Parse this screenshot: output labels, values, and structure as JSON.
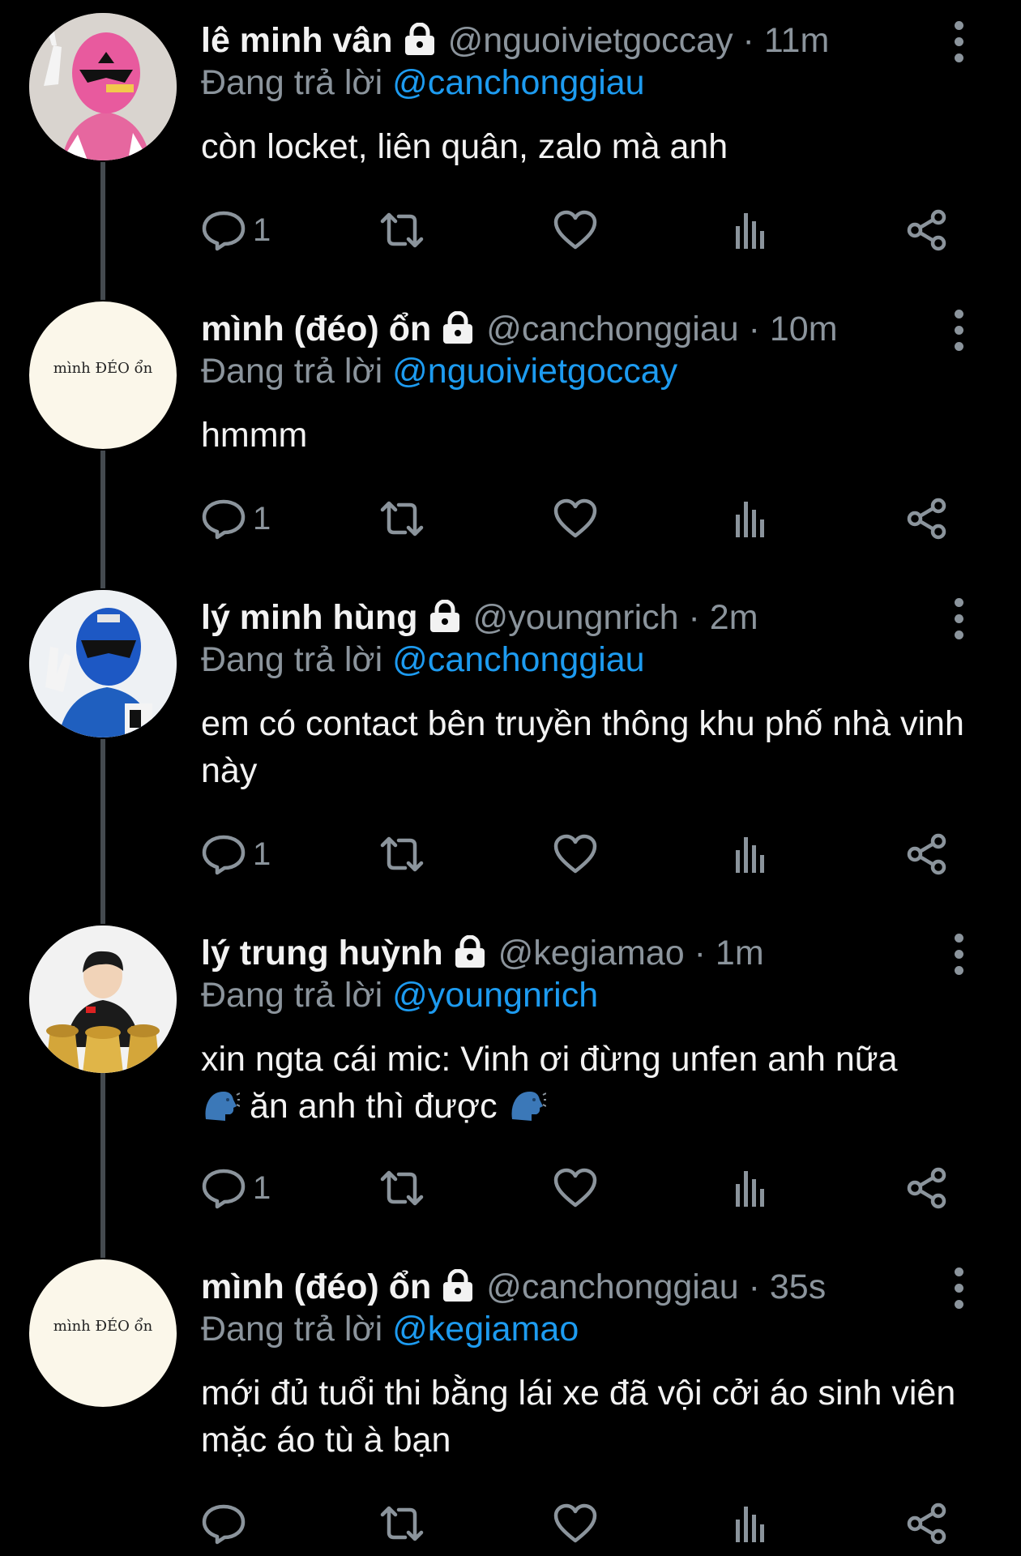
{
  "reply_prefix": "Đang trả lời",
  "tweets": [
    {
      "name": "lê minh vân",
      "handle": "@nguoivietgoccay",
      "time": "11m",
      "reply_to": "@canchonggiau",
      "text": "còn locket, liên quân, zalo mà anh",
      "reply_count": "1",
      "avatar": "pink-ranger-avatar"
    },
    {
      "name": "mình (đéo) ổn",
      "handle": "@canchonggiau",
      "time": "10m",
      "reply_to": "@nguoivietgoccay",
      "text": "hmmm",
      "reply_count": "1",
      "avatar_text": "mình ĐÉO ổn"
    },
    {
      "name": "lý minh hùng",
      "handle": "@youngnrich",
      "time": "2m",
      "reply_to": "@canchonggiau",
      "text": "em có contact bên truyền thông khu phố nhà vinh này",
      "reply_count": "1",
      "avatar": "blue-ranger-avatar"
    },
    {
      "name": "lý trung huỳnh",
      "handle": "@kegiamao",
      "time": "1m",
      "reply_to": "@youngnrich",
      "text_part1": "xin ngta cái mic: Vinh ơi đừng unfen anh nữa",
      "text_part2": "ăn anh thì được",
      "reply_count": "1",
      "avatar": "trophy-person-avatar"
    },
    {
      "name": "mình (đéo) ổn",
      "handle": "@canchonggiau",
      "time": "35s",
      "reply_to": "@kegiamao",
      "text": "mới đủ tuổi thi bằng lái xe đã vội cởi áo sinh viên mặc áo tù à bạn",
      "reply_count": "",
      "avatar_text": "mình ĐÉO ổn"
    }
  ],
  "colors": {
    "background": "#000000",
    "text": "#f2f2f2",
    "muted": "#8b949c",
    "mention": "#1d9bf0",
    "thread_line": "#444a4f"
  }
}
